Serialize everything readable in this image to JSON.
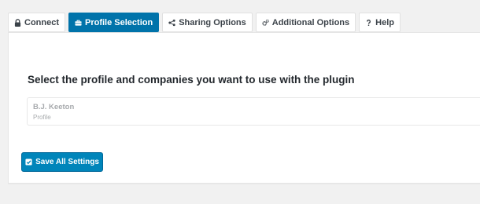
{
  "tabs": [
    {
      "label": "Connect",
      "icon": "lock-icon",
      "active": false
    },
    {
      "label": "Profile Selection",
      "icon": "briefcase-icon",
      "active": true
    },
    {
      "label": "Sharing Options",
      "icon": "share-icon",
      "active": false
    },
    {
      "label": "Additional Options",
      "icon": "gears-icon",
      "active": false
    },
    {
      "label": "Help",
      "icon": "question-icon",
      "active": false
    }
  ],
  "panel": {
    "heading": "Select the profile and companies you want to use with the plugin",
    "profile": {
      "name": "B.J. Keeton",
      "type": "Profile"
    }
  },
  "save_button": {
    "label": "Save All Settings",
    "icon": "checkbox-icon"
  },
  "colors": {
    "accent": "#0073aa",
    "button": "#0085ba",
    "background": "#f1f1f1"
  }
}
